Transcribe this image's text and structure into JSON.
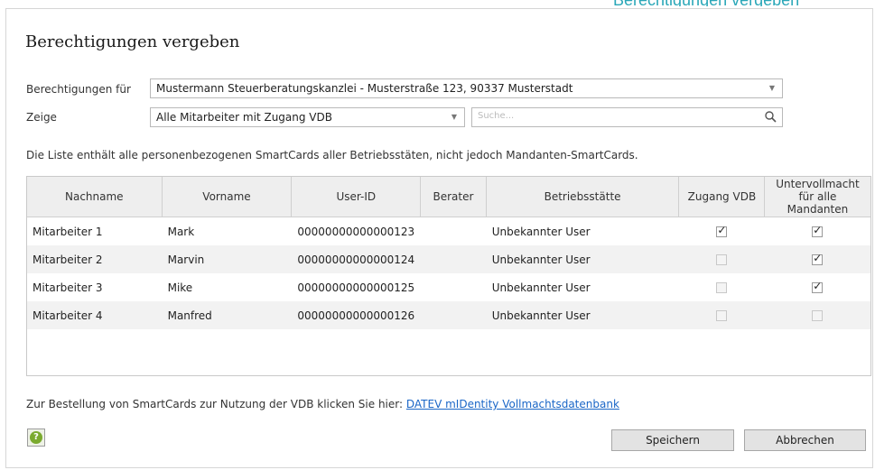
{
  "colors": {
    "teal_accent": "#2aa7b8",
    "link": "#1a66c7",
    "header_bg": "#eeeeee",
    "row_alt": "#f2f2f2"
  },
  "dialog": {
    "title": "Berechtigungen vergeben",
    "berechtigungen_label": "Berechtigungen für",
    "berechtigungen_value": "Mustermann  Steuerberatungskanzlei - Musterstraße 123, 90337 Musterstadt",
    "zeige_label": "Zeige",
    "zeige_value": "Alle Mitarbeiter mit Zugang VDB",
    "search_placeholder": "Suche...",
    "info_text": "Die Liste enthält alle personenbezogenen SmartCards aller Betriebsstäten, nicht jedoch Mandanten-SmartCards."
  },
  "table": {
    "headers": [
      "Nachname",
      "Vorname",
      "User-ID",
      "Berater",
      "Betriebsstätte",
      "Zugang VDB",
      "Untervollmacht für alle Mandanten"
    ],
    "rows": [
      {
        "nachname": "Mitarbeiter 1",
        "vorname": "Mark",
        "userid": "00000000000000123",
        "berater": "",
        "betriebsstaette": "Unbekannter User",
        "zugang_vdb": true,
        "untervollmacht": true
      },
      {
        "nachname": "Mitarbeiter 2",
        "vorname": "Marvin",
        "userid": "00000000000000124",
        "berater": "",
        "betriebsstaette": "Unbekannter User",
        "zugang_vdb": false,
        "untervollmacht": true
      },
      {
        "nachname": "Mitarbeiter 3",
        "vorname": "Mike",
        "userid": "00000000000000125",
        "berater": "",
        "betriebsstaette": "Unbekannter User",
        "zugang_vdb": false,
        "untervollmacht": true
      },
      {
        "nachname": "Mitarbeiter 4",
        "vorname": "Manfred",
        "userid": "00000000000000126",
        "berater": "",
        "betriebsstaette": "Unbekannter User",
        "zugang_vdb": false,
        "untervollmacht": false
      }
    ]
  },
  "footer": {
    "order_text": "Zur Bestellung von SmartCards zur Nutzung der VDB klicken Sie hier: ",
    "order_link": "DATEV mIDentity Vollmachtsdatenbank",
    "save_label": "Speichern",
    "cancel_label": "Abbrechen",
    "help_icon": "help-icon"
  }
}
